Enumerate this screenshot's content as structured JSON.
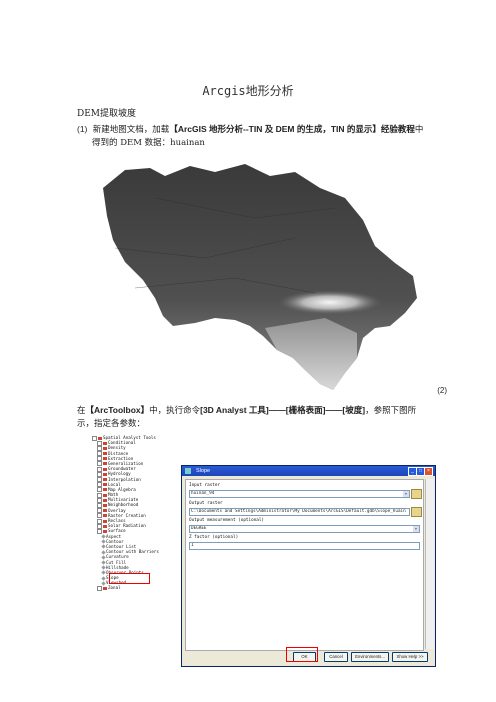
{
  "doc": {
    "title": "Arcgis地形分析",
    "section": "DEM提取坡度",
    "para1_num": "(1)",
    "para1_pre": "新建地图文档，加载",
    "para1_bold": "【ArcGIS 地形分析--TIN 及 DEM 的生成，TIN 的显示】经验教程",
    "para1_post": "中",
    "para1_line2": "得到的 DEM 数据：huainan",
    "fig_num": "(2)",
    "para2_pre": "在",
    "para2_b1": "【ArcToolbox】",
    "para2_mid": "中，执行命令",
    "para2_b2": "[3D Analyst 工具]——[栅格表面]——[坡度]",
    "para2_post": "，参照下图所",
    "para2_line2": "示，指定各参数："
  },
  "tree": [
    {
      "label": "Spatial Analyst Tools",
      "level": 0,
      "type": "box"
    },
    {
      "label": "Conditional",
      "level": 1,
      "type": "box"
    },
    {
      "label": "Density",
      "level": 1,
      "type": "box"
    },
    {
      "label": "Distance",
      "level": 1,
      "type": "box"
    },
    {
      "label": "Extraction",
      "level": 1,
      "type": "box"
    },
    {
      "label": "Generalization",
      "level": 1,
      "type": "box"
    },
    {
      "label": "Groundwater",
      "level": 1,
      "type": "box"
    },
    {
      "label": "Hydrology",
      "level": 1,
      "type": "box"
    },
    {
      "label": "Interpolation",
      "level": 1,
      "type": "box"
    },
    {
      "label": "Local",
      "level": 1,
      "type": "box"
    },
    {
      "label": "Map Algebra",
      "level": 1,
      "type": "box"
    },
    {
      "label": "Math",
      "level": 1,
      "type": "box"
    },
    {
      "label": "Multivariate",
      "level": 1,
      "type": "box"
    },
    {
      "label": "Neighborhood",
      "level": 1,
      "type": "box"
    },
    {
      "label": "Overlay",
      "level": 1,
      "type": "box"
    },
    {
      "label": "Raster Creation",
      "level": 1,
      "type": "box"
    },
    {
      "label": "Reclass",
      "level": 1,
      "type": "box"
    },
    {
      "label": "Solar Radiation",
      "level": 1,
      "type": "box"
    },
    {
      "label": "Surface",
      "level": 1,
      "type": "box"
    },
    {
      "label": "Aspect",
      "level": 2,
      "type": "tool"
    },
    {
      "label": "Contour",
      "level": 2,
      "type": "tool"
    },
    {
      "label": "Contour List",
      "level": 2,
      "type": "tool"
    },
    {
      "label": "Contour with Barriers",
      "level": 2,
      "type": "tool"
    },
    {
      "label": "Curvature",
      "level": 2,
      "type": "tool"
    },
    {
      "label": "Cut Fill",
      "level": 2,
      "type": "tool"
    },
    {
      "label": "Hillshade",
      "level": 2,
      "type": "tool"
    },
    {
      "label": "Observer Points",
      "level": 2,
      "type": "tool"
    },
    {
      "label": "Slope",
      "level": 2,
      "type": "tool"
    },
    {
      "label": "Viewshed",
      "level": 2,
      "type": "tool"
    },
    {
      "label": "Zonal",
      "level": 1,
      "type": "box"
    }
  ],
  "dialog": {
    "title": "Slope",
    "input_label": "Input raster",
    "input_value": "huinan_94",
    "output_label": "Output raster",
    "output_value": "C:\\Documents and Settings\\Administrator\\My Documents\\ArcGIS\\Default.gdb\\Slope_huain",
    "measure_label": "Output measurement (optional)",
    "measure_value": "DEGREE",
    "z_label": "Z factor (optional)",
    "z_value": "1",
    "ok": "OK",
    "cancel": "Cancel",
    "env": "Environments...",
    "help": "Show Help >>"
  }
}
